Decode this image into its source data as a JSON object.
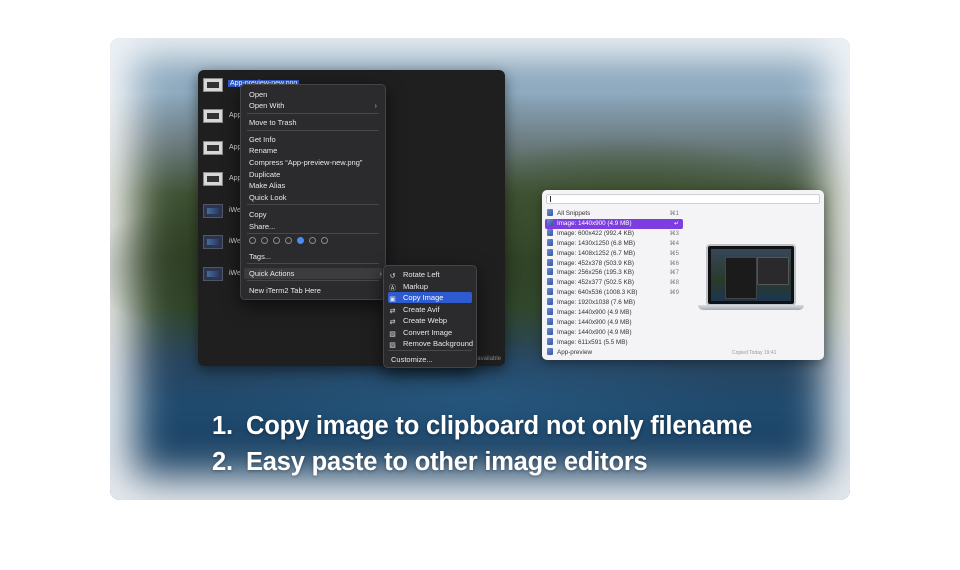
{
  "finder": {
    "files": [
      {
        "name": "App-preview-new.png",
        "selected": true,
        "kind": "png"
      },
      {
        "name": "App",
        "selected": false,
        "kind": "png"
      },
      {
        "name": "App",
        "selected": false,
        "kind": "png"
      },
      {
        "name": "App",
        "selected": false,
        "kind": "png"
      },
      {
        "name": "iWeb",
        "selected": false,
        "kind": "web"
      },
      {
        "name": "iWeb",
        "selected": false,
        "kind": "web"
      },
      {
        "name": "iWeb",
        "selected": false,
        "kind": "web"
      }
    ],
    "footer": "GB available"
  },
  "context_menu": {
    "items": [
      {
        "label": "Open"
      },
      {
        "label": "Open With",
        "submenu": true
      },
      {
        "label": "Move to Trash"
      },
      {
        "label": "Get Info"
      },
      {
        "label": "Rename"
      },
      {
        "label": "Compress “App-preview-new.png”"
      },
      {
        "label": "Duplicate"
      },
      {
        "label": "Make Alias"
      },
      {
        "label": "Quick Look"
      },
      {
        "label": "Copy"
      },
      {
        "label": "Share..."
      },
      {
        "label": "Tags..."
      },
      {
        "label": "Quick Actions",
        "submenu": true,
        "highlighted": true
      },
      {
        "label": "New iTerm2 Tab Here"
      }
    ],
    "tag_dots": 7,
    "tag_selected_index": 4
  },
  "quick_actions": {
    "items": [
      {
        "label": "Rotate Left",
        "icon": "rotate-left-icon",
        "glyph": "↺"
      },
      {
        "label": "Markup",
        "icon": "markup-icon",
        "glyph": "Ⓐ"
      },
      {
        "label": "Copy Image",
        "icon": "copy-image-icon",
        "glyph": "▣",
        "highlighted": true
      },
      {
        "label": "Create Avif",
        "icon": "convert-icon",
        "glyph": "⇄"
      },
      {
        "label": "Create Webp",
        "icon": "convert-icon",
        "glyph": "⇄"
      },
      {
        "label": "Convert Image",
        "icon": "image-icon",
        "glyph": "▧"
      },
      {
        "label": "Remove Background",
        "icon": "remove-background-icon",
        "glyph": "▨"
      },
      {
        "label": "Customize..."
      }
    ]
  },
  "clipboard": {
    "items": [
      {
        "label": "All Snippets",
        "key": "⌘1"
      },
      {
        "label": "Image: 1440x900 (4.9 MB)",
        "key": "↵",
        "selected": true
      },
      {
        "label": "Image: 600x422 (992.4 KB)",
        "key": "⌘3"
      },
      {
        "label": "Image: 1430x1250 (6.8 MB)",
        "key": "⌘4"
      },
      {
        "label": "Image: 1408x1252 (6.7 MB)",
        "key": "⌘5"
      },
      {
        "label": "Image: 452x378 (503.9 KB)",
        "key": "⌘6"
      },
      {
        "label": "Image: 256x256 (195.3 KB)",
        "key": "⌘7"
      },
      {
        "label": "Image: 452x377 (502.5 KB)",
        "key": "⌘8"
      },
      {
        "label": "Image: 640x536 (1008.3 KB)",
        "key": "⌘9"
      },
      {
        "label": "Image: 1920x1038 (7.6 MB)",
        "key": ""
      },
      {
        "label": "Image: 1440x900 (4.9 MB)",
        "key": ""
      },
      {
        "label": "Image: 1440x900 (4.9 MB)",
        "key": ""
      },
      {
        "label": "Image: 1440x900 (4.9 MB)",
        "key": ""
      },
      {
        "label": "Image: 611x591 (5.5 MB)",
        "key": ""
      },
      {
        "label": "App-preview",
        "key": ""
      }
    ],
    "footer": "Copied Today 19:41"
  },
  "caption": {
    "lines": [
      {
        "num": "1.",
        "text": "Copy image to clipboard not only filename"
      },
      {
        "num": "2.",
        "text": "Easy paste to other image editors"
      }
    ]
  },
  "colors": {
    "selection_blue": "#2f5bd0",
    "clipboard_accent": "#7d3ee0",
    "menu_bg": "#2b2b2d"
  }
}
